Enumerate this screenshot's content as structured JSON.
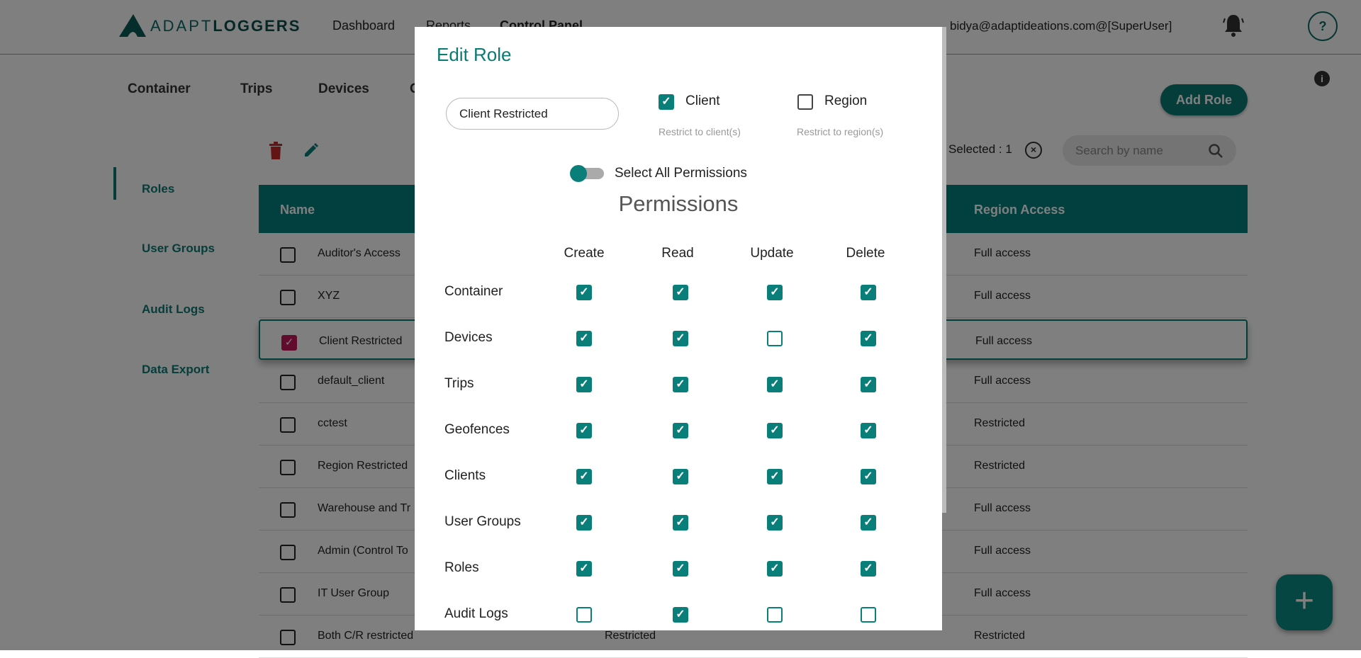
{
  "header": {
    "brand": "ADAPTLOGGERS",
    "brand_a": "ADAPT",
    "brand_b": "LOGGERS",
    "nav": [
      "Dashboard",
      "Reports",
      "Control Panel"
    ],
    "user": "bidya@adaptideations.com@[SuperUser]",
    "help": "?",
    "info": "i"
  },
  "subnav": [
    "Container",
    "Trips",
    "Devices",
    "C"
  ],
  "add_role": "Add Role",
  "sidebar": [
    "Roles",
    "User Groups",
    "Audit Logs",
    "Data Export"
  ],
  "toolbar": {
    "selected": "Selected : 1",
    "search_placeholder": "Search by name"
  },
  "table": {
    "headers": {
      "name": "Name",
      "region": "Region Access"
    },
    "rows": [
      {
        "name": "Auditor's Access",
        "col2": "",
        "region": "Full access",
        "selected": false
      },
      {
        "name": "XYZ",
        "col2": "",
        "region": "Full access",
        "selected": false
      },
      {
        "name": "Client Restricted",
        "col2": "",
        "region": "Full access",
        "selected": true
      },
      {
        "name": "default_client",
        "col2": "",
        "region": "Full access",
        "selected": false
      },
      {
        "name": "cctest",
        "col2": "",
        "region": "Restricted",
        "selected": false
      },
      {
        "name": "Region Restricted",
        "col2": "",
        "region": "Restricted",
        "selected": false
      },
      {
        "name": "Warehouse and Tr",
        "col2": "",
        "region": "Full access",
        "selected": false
      },
      {
        "name": "Admin (Control To",
        "col2": "",
        "region": "Full access",
        "selected": false
      },
      {
        "name": "IT User Group",
        "col2": "",
        "region": "Full access",
        "selected": false
      },
      {
        "name": "Both C/R restricted",
        "col2": "Restricted",
        "region": "Restricted",
        "selected": false
      }
    ]
  },
  "fab": "+",
  "modal": {
    "title": "Edit Role",
    "role_name": "Client Restricted",
    "client": {
      "label": "Client",
      "checked": true,
      "help": "Restrict to client(s)"
    },
    "region": {
      "label": "Region",
      "checked": false,
      "help": "Restrict to region(s)"
    },
    "select_all": {
      "label": "Select All Permissions",
      "on": false
    },
    "permissions_title": "Permissions",
    "columns": [
      "Create",
      "Read",
      "Update",
      "Delete"
    ],
    "rows": [
      {
        "label": "Container",
        "values": [
          true,
          true,
          true,
          true
        ]
      },
      {
        "label": "Devices",
        "values": [
          true,
          true,
          false,
          true
        ]
      },
      {
        "label": "Trips",
        "values": [
          true,
          true,
          true,
          true
        ]
      },
      {
        "label": "Geofences",
        "values": [
          true,
          true,
          true,
          true
        ]
      },
      {
        "label": "Clients",
        "values": [
          true,
          true,
          true,
          true
        ]
      },
      {
        "label": "User Groups",
        "values": [
          true,
          true,
          true,
          true
        ]
      },
      {
        "label": "Roles",
        "values": [
          true,
          true,
          true,
          true
        ]
      },
      {
        "label": "Audit Logs",
        "values": [
          false,
          true,
          false,
          false
        ]
      }
    ]
  },
  "colors": {
    "teal": "#0a7f7a",
    "selected_checkbox": "#c2185b",
    "delete": "#c62828"
  }
}
